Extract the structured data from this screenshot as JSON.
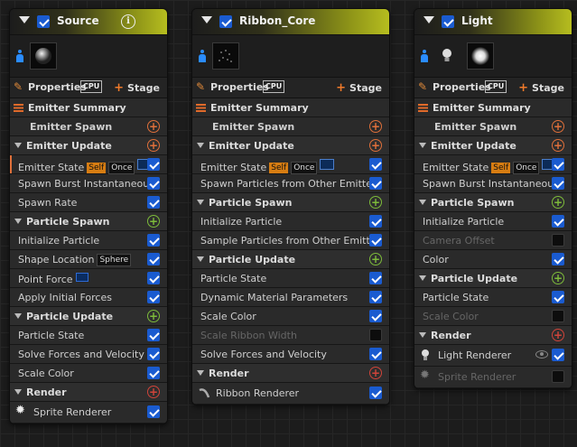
{
  "colors": {
    "spawn_green": "#7dbb3a",
    "update_orange": "#e0703a",
    "render_red": "#d0443a",
    "emitter_orange": "#e07a32",
    "checkbox_blue": "#1a5bd0"
  },
  "common": {
    "properties": "Properties",
    "cpu": "CPU",
    "stage": "Stage",
    "emitter_summary": "Emitter Summary",
    "emitter_spawn": "Emitter Spawn",
    "emitter_update": "Emitter Update",
    "particle_spawn": "Particle Spawn",
    "particle_update": "Particle Update",
    "render": "Render"
  },
  "source": {
    "title": "Source",
    "info": "i",
    "emitter_update_items": [
      {
        "label": "Emitter State",
        "tag_self": "Self",
        "tag_once": "Once"
      },
      {
        "label": "Spawn Burst Instantaneous"
      },
      {
        "label": "Spawn Rate"
      }
    ],
    "particle_spawn_items": [
      {
        "label": "Initialize Particle"
      },
      {
        "label": "Shape Location",
        "tag": "Sphere"
      },
      {
        "label": "Point Force"
      },
      {
        "label": "Apply Initial Forces"
      }
    ],
    "particle_update_items": [
      {
        "label": "Particle State"
      },
      {
        "label": "Solve Forces and Velocity"
      },
      {
        "label": "Scale Color"
      }
    ],
    "render_items": [
      {
        "label": "Sprite Renderer"
      }
    ]
  },
  "ribbon": {
    "title": "Ribbon_Core",
    "emitter_update_items": [
      {
        "label": "Emitter State",
        "tag_self": "Self",
        "tag_once": "Once"
      },
      {
        "label": "Spawn Particles from Other Emitter"
      }
    ],
    "particle_spawn_items": [
      {
        "label": "Initialize Particle"
      },
      {
        "label": "Sample Particles from Other Emitter"
      }
    ],
    "particle_update_items": [
      {
        "label": "Particle State"
      },
      {
        "label": "Dynamic Material Parameters"
      },
      {
        "label": "Scale Color"
      },
      {
        "label": "Scale Ribbon Width"
      },
      {
        "label": "Solve Forces and Velocity"
      }
    ],
    "render_items": [
      {
        "label": "Ribbon Renderer"
      }
    ]
  },
  "light": {
    "title": "Light",
    "emitter_update_items": [
      {
        "label": "Emitter State",
        "tag_self": "Self",
        "tag_once": "Once"
      },
      {
        "label": "Spawn Burst Instantaneous"
      }
    ],
    "particle_spawn_items": [
      {
        "label": "Initialize Particle"
      },
      {
        "label": "Camera Offset"
      },
      {
        "label": "Color"
      }
    ],
    "particle_update_items": [
      {
        "label": "Particle State"
      },
      {
        "label": "Scale Color"
      }
    ],
    "render_items": [
      {
        "label": "Light Renderer"
      },
      {
        "label": "Sprite Renderer"
      }
    ]
  }
}
